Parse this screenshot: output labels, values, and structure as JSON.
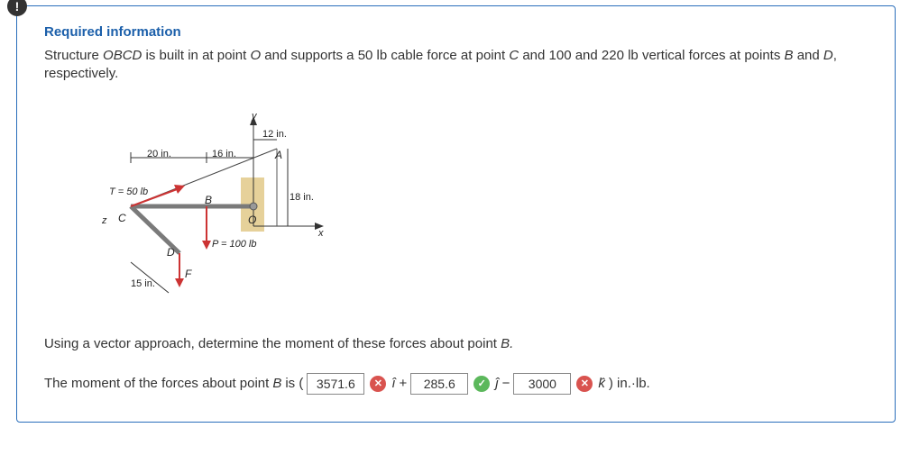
{
  "alert_glyph": "!",
  "header": "Required information",
  "problem_html_1": "Structure ",
  "problem_html_2": "OBCD",
  "problem_html_3": " is built in at point ",
  "problem_html_4": "O",
  "problem_html_5": " and supports a 50 lb cable force at point ",
  "problem_html_6": "C",
  "problem_html_7": " and 100 and 220 lb vertical forces at points ",
  "problem_html_8": "B",
  "problem_html_9": " and ",
  "problem_html_10": "D",
  "problem_html_11": ", respectively.",
  "diagram": {
    "dim_20in": "20 in.",
    "dim_16in": "16 in.",
    "dim_12in": "12 in.",
    "dim_18in": "18 in.",
    "dim_15in": "15 in.",
    "T_label": "T = 50 lb",
    "P_label": "P = 100 lb",
    "axis_y": "y",
    "axis_x": "x",
    "axis_z": "z",
    "pt_A": "A",
    "pt_B": "B",
    "pt_C": "C",
    "pt_D": "D",
    "pt_F": "F",
    "pt_O": "O"
  },
  "question_1": "Using a vector approach, determine the moment of these forces about point ",
  "question_2": "B.",
  "answer": {
    "prefix_1": "The moment of the forces about point ",
    "prefix_2": "B",
    "prefix_3": " is (",
    "val_i": "3571.6",
    "unit_i": "î",
    "plus": " + ",
    "val_j": "285.6",
    "unit_j": "ĵ",
    "minus": " − ",
    "val_k": "3000",
    "unit_k": "k̂",
    "suffix": ") in.·lb."
  }
}
